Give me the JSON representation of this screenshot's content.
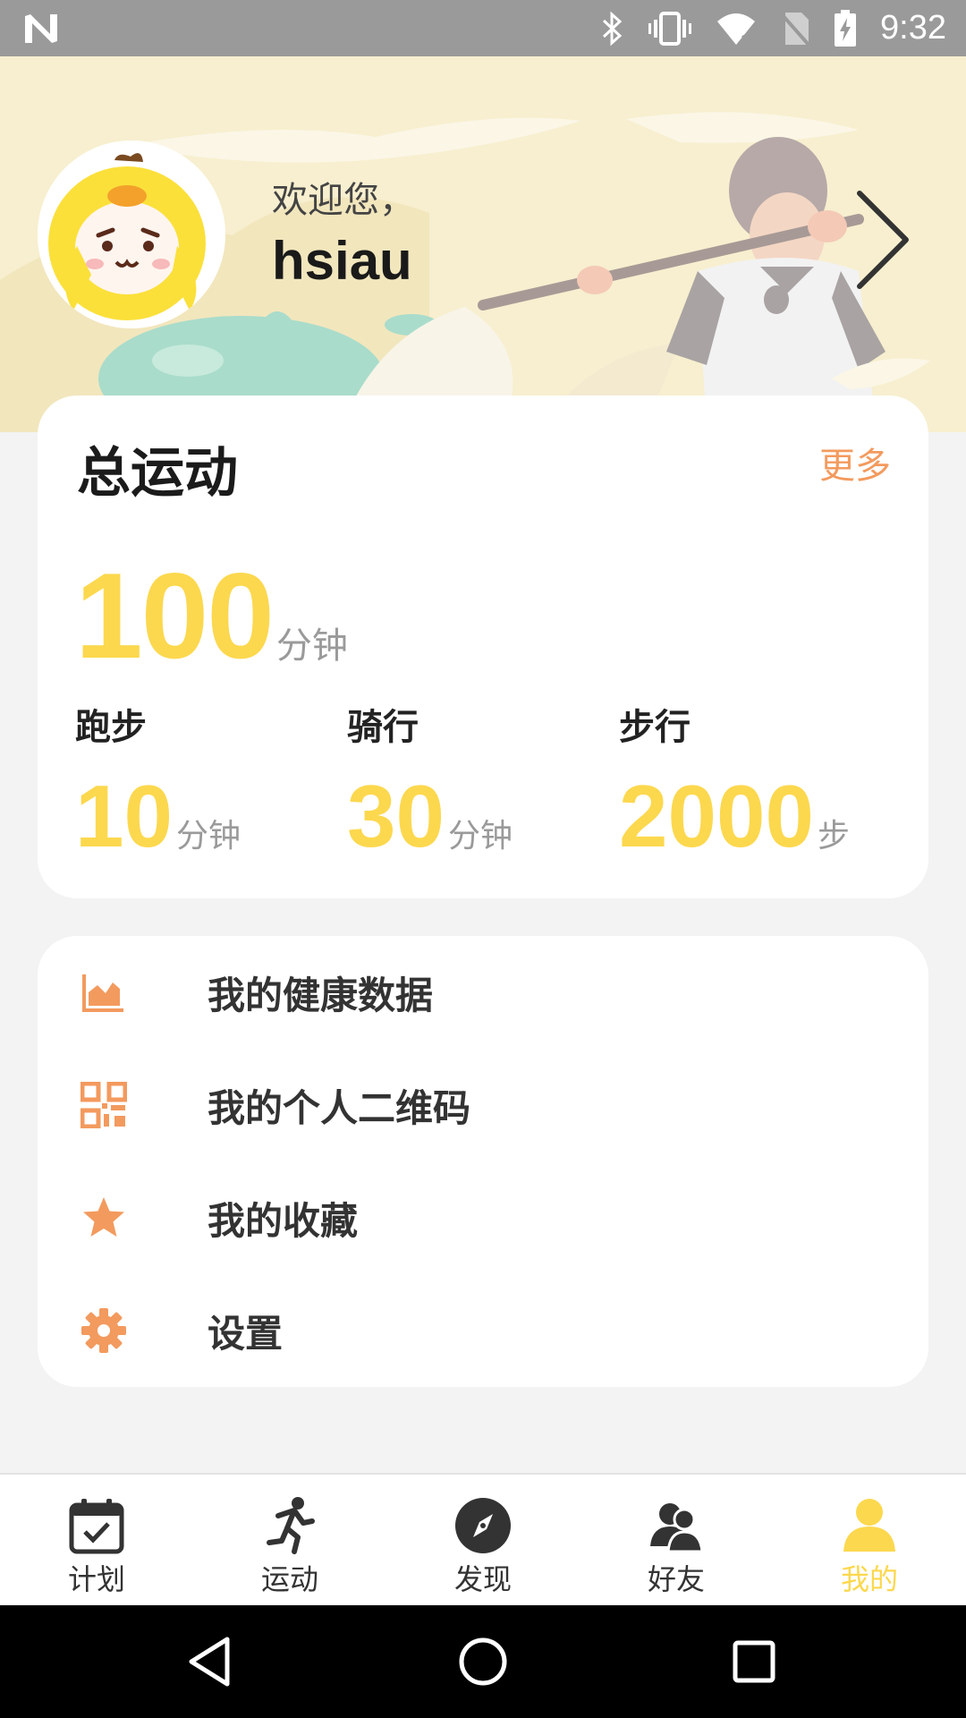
{
  "status_bar": {
    "time": "9:32",
    "icons": [
      "n-logo-icon",
      "bluetooth-icon",
      "vibrate-icon",
      "wifi-icon",
      "no-sim-icon",
      "battery-charging-icon"
    ]
  },
  "header": {
    "welcome_text": "欢迎您，",
    "username": "hsiau",
    "avatar_icon": "cartoon-avatar-icon",
    "chevron_icon": "chevron-right-icon"
  },
  "summary": {
    "title": "总运动",
    "more_label": "更多",
    "total_value": "100",
    "total_unit": "分钟",
    "stats": [
      {
        "label": "跑步",
        "value": "10",
        "unit": "分钟"
      },
      {
        "label": "骑行",
        "value": "30",
        "unit": "分钟"
      },
      {
        "label": "步行",
        "value": "2000",
        "unit": "步"
      }
    ]
  },
  "menu": {
    "items": [
      {
        "label": "我的健康数据",
        "icon": "area-chart-icon"
      },
      {
        "label": "我的个人二维码",
        "icon": "qr-code-icon"
      },
      {
        "label": "我的收藏",
        "icon": "star-icon"
      },
      {
        "label": "设置",
        "icon": "gear-icon"
      }
    ]
  },
  "bottom_nav": {
    "items": [
      {
        "label": "计划",
        "icon": "calendar-check-icon"
      },
      {
        "label": "运动",
        "icon": "running-icon"
      },
      {
        "label": "发现",
        "icon": "compass-icon"
      },
      {
        "label": "好友",
        "icon": "friends-icon"
      },
      {
        "label": "我的",
        "icon": "person-icon"
      }
    ],
    "active_index": 4
  },
  "colors": {
    "accent_yellow": "#fcd84e",
    "accent_orange": "#f39a5e",
    "header_bg": "#f7efcf",
    "page_bg": "#f3f3f3"
  }
}
